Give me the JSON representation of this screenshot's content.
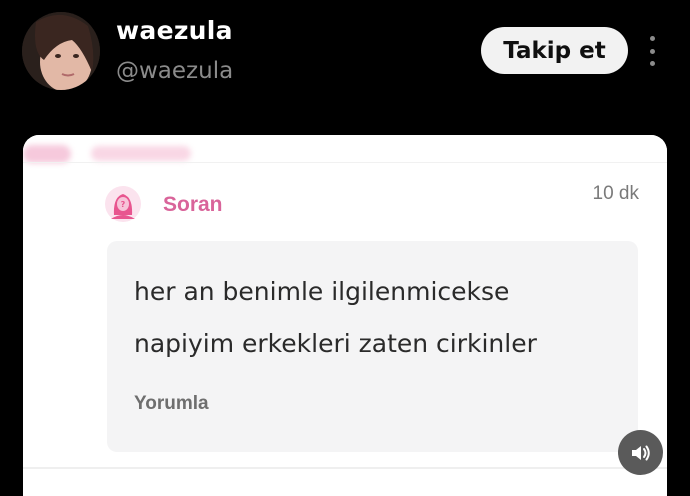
{
  "profile": {
    "display_name": "waezula",
    "handle": "@waezula",
    "follow_label": "Takip et"
  },
  "card": {
    "asker_label": "Soran",
    "timestamp": "10 dk",
    "question_lines": [
      "her an benimle ilgilenmicekse",
      "napiyim erkekleri zaten cirkinler"
    ],
    "comment_label": "Yorumla"
  },
  "icons": {
    "more": "more-vertical-icon",
    "asker": "anonymous-woman-icon",
    "sound": "speaker-icon"
  },
  "colors": {
    "background": "#000000",
    "accent_pink": "#d9649a",
    "follow_button_bg": "#f2f2f2"
  }
}
